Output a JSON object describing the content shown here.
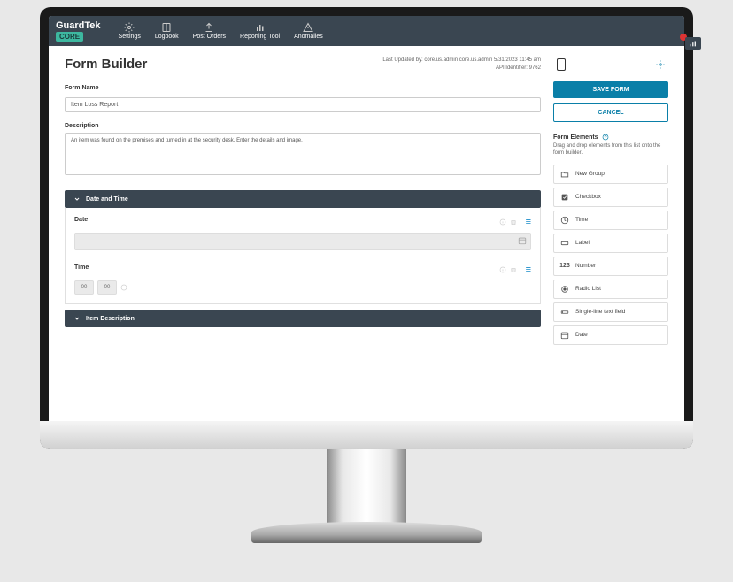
{
  "brand": {
    "name": "GuardTek",
    "sub": "CORE"
  },
  "nav": [
    {
      "label": "Settings"
    },
    {
      "label": "Logbook"
    },
    {
      "label": "Post Orders"
    },
    {
      "label": "Reporting Tool"
    },
    {
      "label": "Anomalies"
    }
  ],
  "page": {
    "title": "Form Builder",
    "updated": "Last Updated by: core.us.admin core.us.admin 5/31/2023 11:45 am",
    "apiId": "API Identifier: 9762"
  },
  "form": {
    "nameLabel": "Form Name",
    "nameValue": "Item Loss Report",
    "descLabel": "Description",
    "descValue": "An item was found on the premises and turned in at the security desk. Enter the details and image."
  },
  "groups": [
    {
      "title": "Date and Time",
      "fields": [
        {
          "label": "Date",
          "type": "date"
        },
        {
          "label": "Time",
          "type": "time",
          "hh": "00",
          "mm": "00"
        }
      ]
    },
    {
      "title": "Item Description",
      "fields": []
    }
  ],
  "sidebar": {
    "save": "SAVE FORM",
    "cancel": "CANCEL",
    "elementsTitle": "Form Elements",
    "hint": "Drag and drop elements from this list onto the form builder.",
    "elements": [
      {
        "label": "New Group",
        "icon": "folder"
      },
      {
        "label": "Checkbox",
        "icon": "checkbox"
      },
      {
        "label": "Time",
        "icon": "clock"
      },
      {
        "label": "Label",
        "icon": "tag"
      },
      {
        "label": "Number",
        "icon": "number"
      },
      {
        "label": "Radio List",
        "icon": "radio"
      },
      {
        "label": "Single-line text field",
        "icon": "text"
      },
      {
        "label": "Date",
        "icon": "calendar"
      }
    ]
  }
}
